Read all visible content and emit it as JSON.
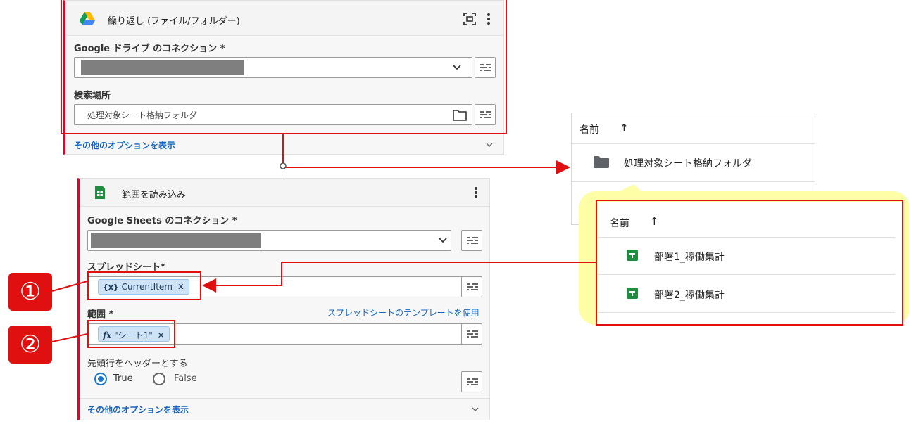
{
  "card1": {
    "title": "繰り返し (ファイル/フォルダー)",
    "connection_label": "Google ドライブ のコネクション *",
    "search_location_label": "検索場所",
    "search_location_value": "処理対象シート格納フォルダ",
    "more_options": "その他のオプションを表示"
  },
  "card2": {
    "title": "範囲を読み込み",
    "connection_label": "Google Sheets のコネクション *",
    "spreadsheet_label": "スプレッドシート*",
    "spreadsheet_chip_prefix": "{x}",
    "spreadsheet_chip": "CurrentItem",
    "range_label": "範囲 *",
    "template_link": "スプレッドシートのテンプレートを使用",
    "range_chip_prefix": "fx",
    "range_chip": "\"シート1\"",
    "header_label": "先頭行をヘッダーとする",
    "radio_true": "True",
    "radio_false": "False",
    "more_options": "その他のオプションを表示"
  },
  "callouts": {
    "one": "①",
    "two": "②"
  },
  "folder_panel": {
    "header": "名前",
    "sort_arrow": "↑",
    "folder_name": "処理対象シート格納フォルダ"
  },
  "sheet_panel": {
    "header": "名前",
    "sort_arrow": "↑",
    "files": [
      "部署1_稼働集計",
      "部署2_稼働集計"
    ]
  },
  "colors": {
    "highlight": "#e01010",
    "link": "#1565c0",
    "callout_bg": "#fefea6",
    "sheets_green": "#1e8e3e"
  },
  "icons": {
    "drive": "google-drive-icon",
    "sheets": "google-sheets-icon",
    "folder": "folder-icon",
    "chevron": "chevron-down-icon",
    "options": "options-icon",
    "menu": "kebab-menu-icon",
    "fit": "fit-screen-icon",
    "close": "close-icon"
  }
}
